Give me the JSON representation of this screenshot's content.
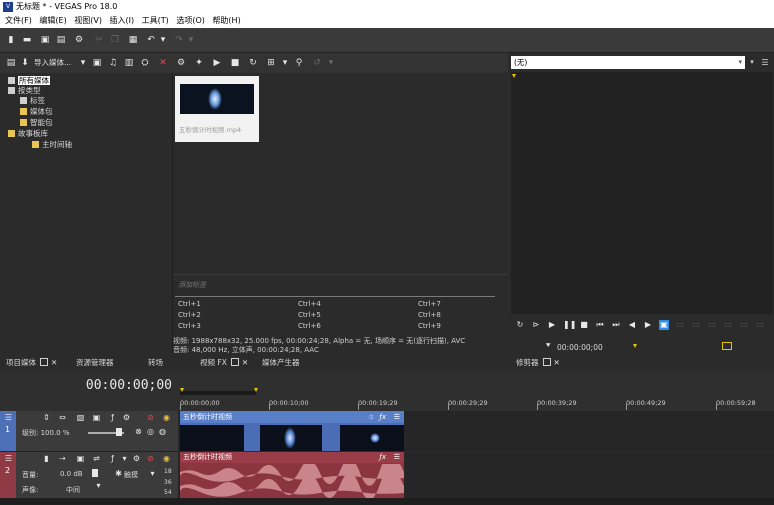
{
  "window": {
    "title": "无标题 * - VEGAS Pro 18.0",
    "app_icon": "vegas-icon"
  },
  "menu": [
    "文件(F)",
    "编辑(E)",
    "视图(V)",
    "插入(I)",
    "工具(T)",
    "选项(O)",
    "帮助(H)"
  ],
  "project_media": {
    "import_label": "导入媒体...",
    "tree": [
      {
        "label": "所有媒体",
        "selected": true
      },
      {
        "label": "按类型",
        "selected": false
      },
      {
        "label": "标签",
        "selected": false
      },
      {
        "label": "媒体包",
        "selected": false
      },
      {
        "label": "智能包",
        "selected": false
      },
      {
        "label": "故事板库",
        "selected": false
      },
      {
        "label": "主时间轴",
        "selected": false
      }
    ],
    "media_file": "五秒倒计时视频.mp4",
    "tag_hint": "添加标签",
    "shortcuts": [
      "Ctrl+1",
      "Ctrl+2",
      "Ctrl+3",
      "Ctrl+4",
      "Ctrl+5",
      "Ctrl+6",
      "Ctrl+7",
      "Ctrl+8",
      "Ctrl+9"
    ],
    "info_video": "视频: 1988x788x32, 25.000 fps, 00:00:24;28, Alpha = 无, 场顺序 = 无(逐行扫描), AVC",
    "info_audio": "音频: 48,000 Hz, 立体声, 00:00:24;28, AAC"
  },
  "left_tabs": {
    "project_media": "项目媒体",
    "explorer": "资源管理器",
    "transitions": "转场",
    "video_fx": "视频 FX",
    "media_generators": "媒体产生器"
  },
  "preview": {
    "device": "(无)",
    "timecode": "00:00:00;00",
    "tab": "修剪器"
  },
  "timeline": {
    "current_time": "00:00:00;00",
    "ruler": [
      "00:00:00;00",
      "00:00:10;00",
      "00:00:19;29",
      "00:00:29;29",
      "00:00:39;29",
      "00:00:49;29",
      "00:00:59;28"
    ],
    "video_track": {
      "number": "1",
      "level_label": "级别: 100.0 %",
      "clip_name": "五秒倒计时视频"
    },
    "audio_track": {
      "number": "2",
      "volume_label": "音量:",
      "volume_value": "0.0 dB",
      "pan_label": "声像:",
      "pan_value": "中间",
      "touch_label": "触摸",
      "meter": [
        "18",
        "36",
        "54"
      ],
      "clip_name": "五秒倒计时视频"
    }
  },
  "colors": {
    "video_clip": "#4a6db6",
    "audio_clip": "#8a3540",
    "accent": "#2f8fe6",
    "marker": "#e7c400"
  }
}
